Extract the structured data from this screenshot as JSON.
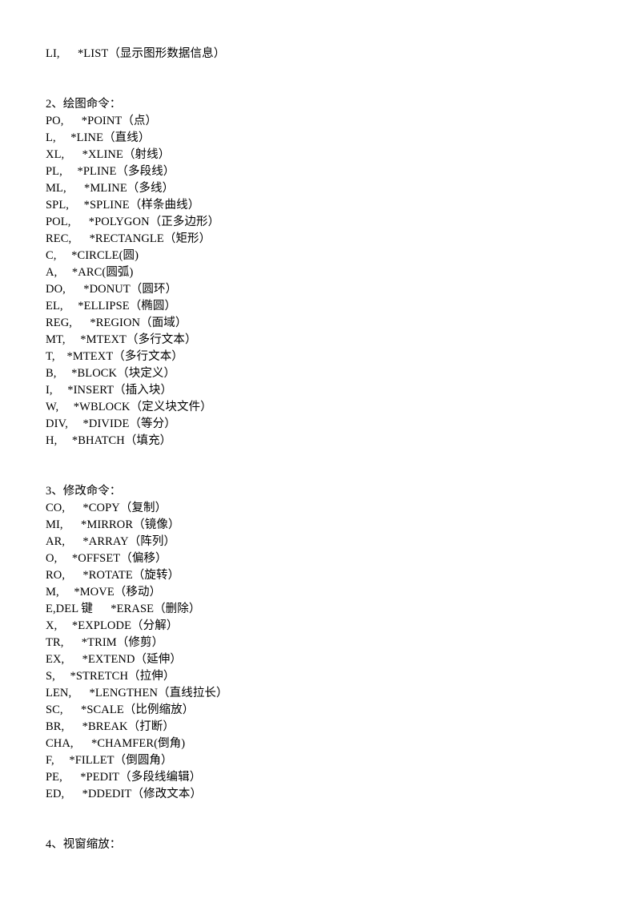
{
  "document": {
    "title": "CAD 命令快捷键参考",
    "background_color": "#ffffff",
    "text_color": "#000000"
  },
  "blocks": [
    {
      "type": "line",
      "name": "command-line-li",
      "text": "LI,      *LIST（显示图形数据信息）"
    },
    {
      "type": "spacer",
      "name": "blank-line-1",
      "size": "big"
    },
    {
      "type": "section-head",
      "name": "section-heading-drawing",
      "text": "2、绘图命令："
    },
    {
      "type": "line",
      "name": "command-line-po",
      "text": "PO,      *POINT（点）"
    },
    {
      "type": "line",
      "name": "command-line-l",
      "text": "L,     *LINE（直线）"
    },
    {
      "type": "line",
      "name": "command-line-xl",
      "text": "XL,      *XLINE（射线）"
    },
    {
      "type": "line",
      "name": "command-line-pl",
      "text": "PL,     *PLINE（多段线）"
    },
    {
      "type": "line",
      "name": "command-line-ml",
      "text": "ML,      *MLINE（多线）"
    },
    {
      "type": "line",
      "name": "command-line-spl",
      "text": "SPL,     *SPLINE（样条曲线）"
    },
    {
      "type": "line",
      "name": "command-line-pol",
      "text": "POL,      *POLYGON（正多边形）"
    },
    {
      "type": "line",
      "name": "command-line-rec",
      "text": "REC,      *RECTANGLE（矩形）"
    },
    {
      "type": "line",
      "name": "command-line-c",
      "text": "C,     *CIRCLE(圆)"
    },
    {
      "type": "line",
      "name": "command-line-a",
      "text": "A,     *ARC(圆弧)"
    },
    {
      "type": "line",
      "name": "command-line-do",
      "text": "DO,      *DONUT（圆环）"
    },
    {
      "type": "line",
      "name": "command-line-el",
      "text": "EL,     *ELLIPSE（椭圆）"
    },
    {
      "type": "line",
      "name": "command-line-reg",
      "text": "REG,      *REGION（面域）"
    },
    {
      "type": "line",
      "name": "command-line-mt",
      "text": "MT,     *MTEXT（多行文本）"
    },
    {
      "type": "line",
      "name": "command-line-t",
      "text": "T,    *MTEXT（多行文本）"
    },
    {
      "type": "line",
      "name": "command-line-b",
      "text": "B,     *BLOCK（块定义）"
    },
    {
      "type": "line",
      "name": "command-line-i",
      "text": "I,     *INSERT（插入块）"
    },
    {
      "type": "line",
      "name": "command-line-w",
      "text": "W,     *WBLOCK（定义块文件）"
    },
    {
      "type": "line",
      "name": "command-line-div",
      "text": "DIV,     *DIVIDE（等分）"
    },
    {
      "type": "line",
      "name": "command-line-h",
      "text": "H,     *BHATCH（填充）"
    },
    {
      "type": "spacer",
      "name": "blank-line-2",
      "size": "big"
    },
    {
      "type": "section-head",
      "name": "section-heading-modify",
      "text": "3、修改命令："
    },
    {
      "type": "line",
      "name": "command-line-co",
      "text": "CO,      *COPY（复制）"
    },
    {
      "type": "line",
      "name": "command-line-mi",
      "text": "MI,      *MIRROR（镜像）"
    },
    {
      "type": "line",
      "name": "command-line-ar",
      "text": "AR,      *ARRAY（阵列）"
    },
    {
      "type": "line",
      "name": "command-line-o",
      "text": "O,     *OFFSET（偏移）"
    },
    {
      "type": "line",
      "name": "command-line-ro",
      "text": "RO,      *ROTATE（旋转）"
    },
    {
      "type": "line",
      "name": "command-line-m",
      "text": "M,     *MOVE（移动）"
    },
    {
      "type": "line",
      "name": "command-line-e",
      "text": "E,DEL 键      *ERASE（删除）"
    },
    {
      "type": "line",
      "name": "command-line-x",
      "text": "X,     *EXPLODE（分解）"
    },
    {
      "type": "line",
      "name": "command-line-tr",
      "text": "TR,      *TRIM（修剪）"
    },
    {
      "type": "line",
      "name": "command-line-ex",
      "text": "EX,      *EXTEND（延伸）"
    },
    {
      "type": "line",
      "name": "command-line-s",
      "text": "S,     *STRETCH（拉伸）"
    },
    {
      "type": "line",
      "name": "command-line-len",
      "text": "LEN,      *LENGTHEN（直线拉长）"
    },
    {
      "type": "line",
      "name": "command-line-sc",
      "text": "SC,      *SCALE（比例缩放）"
    },
    {
      "type": "line",
      "name": "command-line-br",
      "text": "BR,      *BREAK（打断）"
    },
    {
      "type": "line",
      "name": "command-line-cha",
      "text": "CHA,      *CHAMFER(倒角)"
    },
    {
      "type": "line",
      "name": "command-line-f",
      "text": "F,     *FILLET（倒圆角）"
    },
    {
      "type": "line",
      "name": "command-line-pe",
      "text": "PE,      *PEDIT（多段线编辑）"
    },
    {
      "type": "line",
      "name": "command-line-ed",
      "text": "ED,      *DDEDIT（修改文本）"
    },
    {
      "type": "spacer",
      "name": "blank-line-3",
      "size": "big"
    },
    {
      "type": "section-head",
      "name": "section-heading-zoom",
      "text": "4、视窗缩放："
    }
  ]
}
